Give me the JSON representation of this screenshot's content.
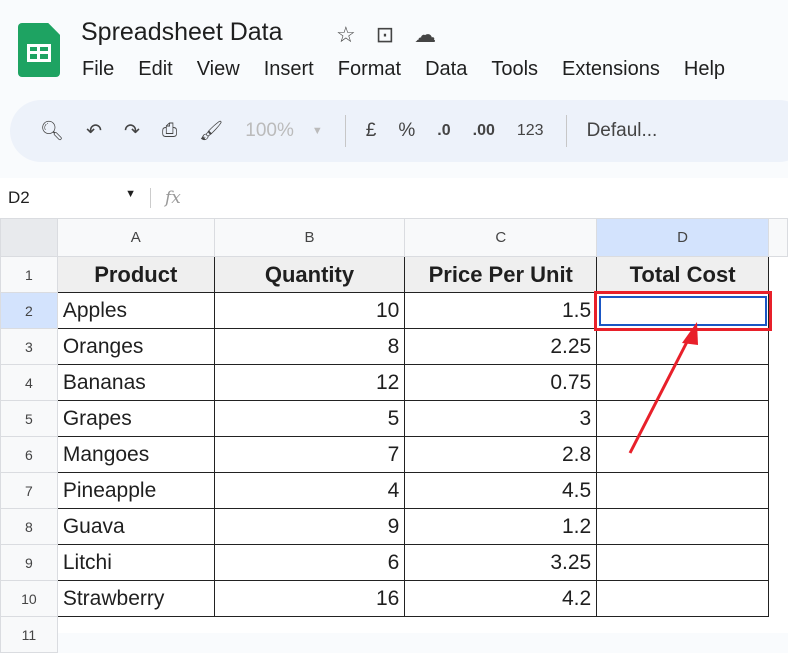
{
  "app": {
    "title": "Spreadsheet Data",
    "menu": [
      "File",
      "Edit",
      "View",
      "Insert",
      "Format",
      "Data",
      "Tools",
      "Extensions",
      "Help"
    ]
  },
  "toolbar": {
    "zoom": "100%",
    "currency": "£",
    "percent": "%",
    "dec_decrease": ".0",
    "dec_increase": ".00",
    "format_number": "123",
    "font": "Defaul..."
  },
  "formula_bar": {
    "cell_ref": "D2",
    "fx": "fx",
    "value": ""
  },
  "columns": [
    "A",
    "B",
    "C",
    "D"
  ],
  "rows": [
    "1",
    "2",
    "3",
    "4",
    "5",
    "6",
    "7",
    "8",
    "9",
    "10",
    "11"
  ],
  "table": {
    "headers": [
      "Product",
      "Quantity",
      "Price Per Unit",
      "Total Cost"
    ],
    "data": [
      [
        "Apples",
        "10",
        "1.5",
        ""
      ],
      [
        "Oranges",
        "8",
        "2.25",
        ""
      ],
      [
        "Bananas",
        "12",
        "0.75",
        ""
      ],
      [
        "Grapes",
        "5",
        "3",
        ""
      ],
      [
        "Mangoes",
        "7",
        "2.8",
        ""
      ],
      [
        "Pineapple",
        "4",
        "4.5",
        ""
      ],
      [
        "Guava",
        "9",
        "1.2",
        ""
      ],
      [
        "Litchi",
        "6",
        "3.25",
        ""
      ],
      [
        "Strawberry",
        "16",
        "4.2",
        ""
      ]
    ]
  },
  "colors": {
    "highlight": "#e8202a",
    "selection": "#1a56c4",
    "brand": "#1ea362"
  }
}
